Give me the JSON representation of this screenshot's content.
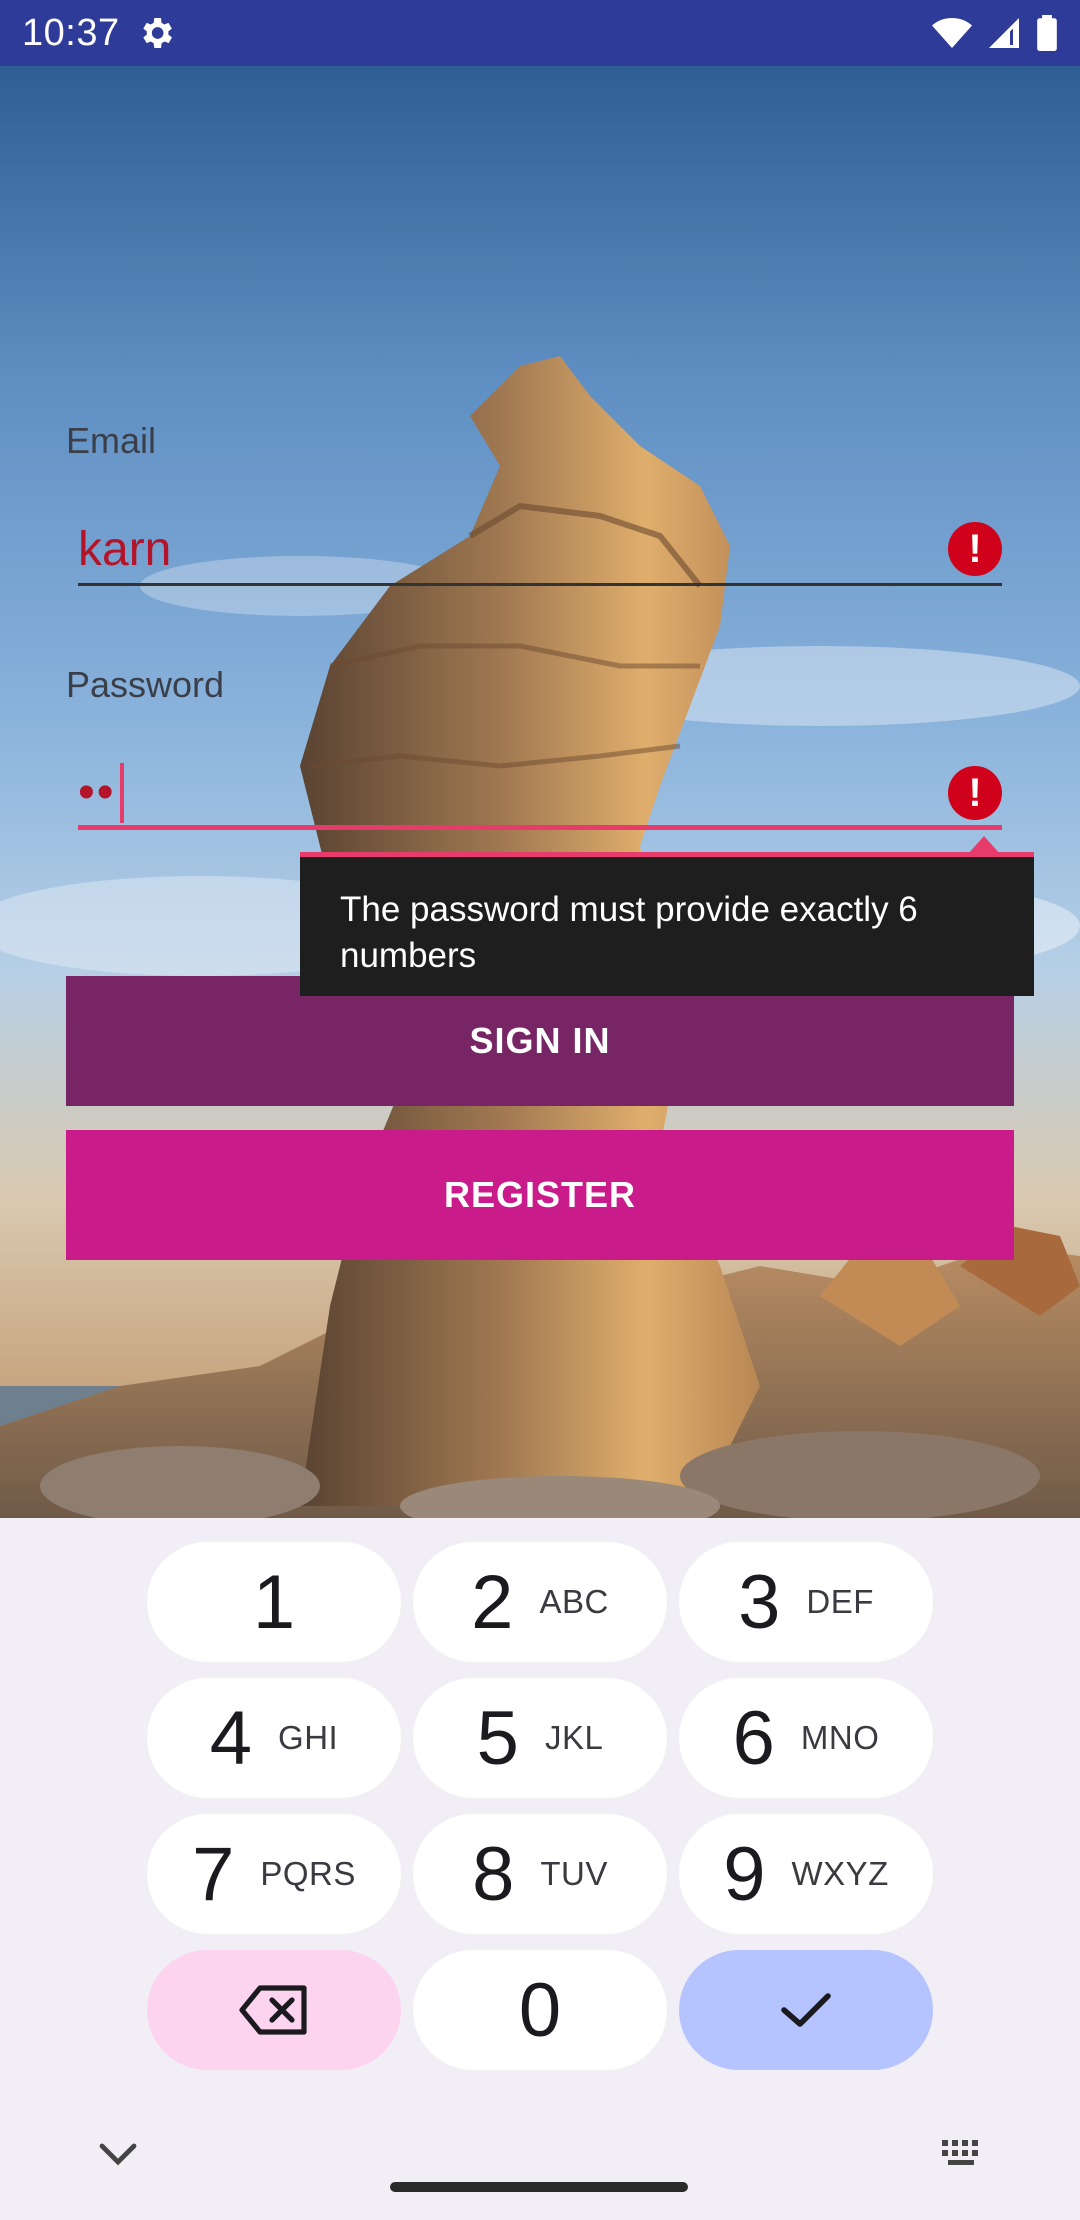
{
  "status_bar": {
    "time": "10:37"
  },
  "form": {
    "email_label": "Email",
    "email_value": "karn",
    "password_label": "Password",
    "password_value_masked": "••",
    "error_message": "The password must provide exactly 6 numbers",
    "error_color": "#d0021b",
    "accent_color": "#e73c6b"
  },
  "buttons": {
    "sign_in_label": "SIGN IN",
    "register_label": "REGISTER",
    "sign_in_color": "#772565",
    "register_color": "#c91b89"
  },
  "keyboard": {
    "keys": [
      {
        "digit": "1",
        "letters": ""
      },
      {
        "digit": "2",
        "letters": "ABC"
      },
      {
        "digit": "3",
        "letters": "DEF"
      },
      {
        "digit": "4",
        "letters": "GHI"
      },
      {
        "digit": "5",
        "letters": "JKL"
      },
      {
        "digit": "6",
        "letters": "MNO"
      },
      {
        "digit": "7",
        "letters": "PQRS"
      },
      {
        "digit": "8",
        "letters": "TUV"
      },
      {
        "digit": "9",
        "letters": "WXYZ"
      },
      {
        "digit": "0",
        "letters": ""
      }
    ],
    "delete_icon": "backspace-icon",
    "done_icon": "check-icon",
    "collapse_icon": "chevron-down-icon",
    "switch_icon": "keyboard-icon"
  }
}
